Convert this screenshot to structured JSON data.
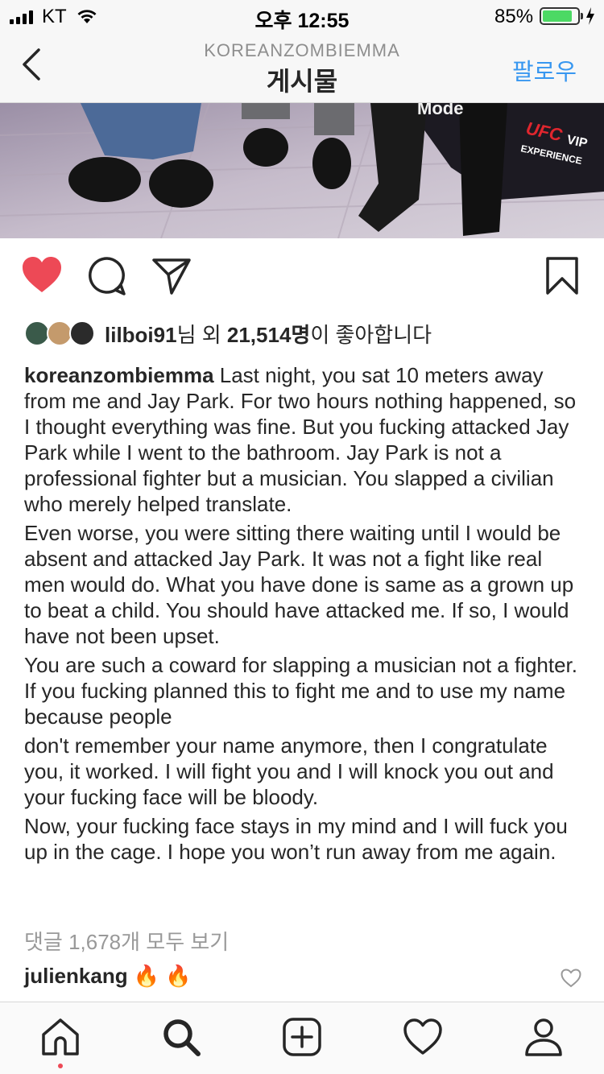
{
  "status_bar": {
    "carrier": "KT",
    "time": "오후 12:55",
    "battery_percent": "85%",
    "battery_level": 0.85,
    "battery_color": "#4cd964"
  },
  "nav": {
    "username": "KOREANZOMBIEMMA",
    "title": "게시물",
    "follow_label": "팔로우",
    "back_icon": "chevron-left-icon"
  },
  "photo": {
    "signage": [
      "Mode",
      "UFC",
      "VIP",
      "EXPERIENCE"
    ]
  },
  "actions": {
    "liked": true,
    "like_color": "#ed4956",
    "icons": [
      "heart-filled-icon",
      "comment-icon",
      "share-icon",
      "bookmark-icon"
    ]
  },
  "likes": {
    "user": "lilboi91",
    "suffix1": "님 외 ",
    "count": "21,514명",
    "suffix2": "이 좋아합니다"
  },
  "caption": {
    "username": "koreanzombiemma",
    "paragraphs": [
      "Last night, you sat 10 meters away from me and Jay Park. For two hours nothing happened, so I thought everything was fine. But you fucking attacked Jay Park while I went to the bathroom. Jay Park is not a professional fighter but a musician. You slapped a civilian who merely helped translate.",
      "Even worse, you were sitting there waiting until I would be absent and attacked Jay Park. It was not a fight like real men would do.  What you have done is same as a grown up to beat a child. You should have attacked me. If so, I would have not been upset.",
      "You are such a coward for slapping a musician not a fighter. If you fucking planned this to fight me and to use my name because people",
      "don't remember your name anymore, then I congratulate you, it worked. I will fight you and I will knock you out and your fucking face will be bloody.",
      "Now, your fucking face stays in my mind and I will fuck you up in the cage. I hope you won’t run away from me again."
    ]
  },
  "comments": {
    "view_all": "댓글 1,678개 모두 보기",
    "first": {
      "user": "julienkang",
      "text": "🔥 🔥"
    }
  },
  "tabbar": {
    "tabs": [
      "home-icon",
      "search-icon",
      "new-post-icon",
      "activity-icon",
      "profile-icon"
    ],
    "notification_dot_color": "#ed4956"
  }
}
